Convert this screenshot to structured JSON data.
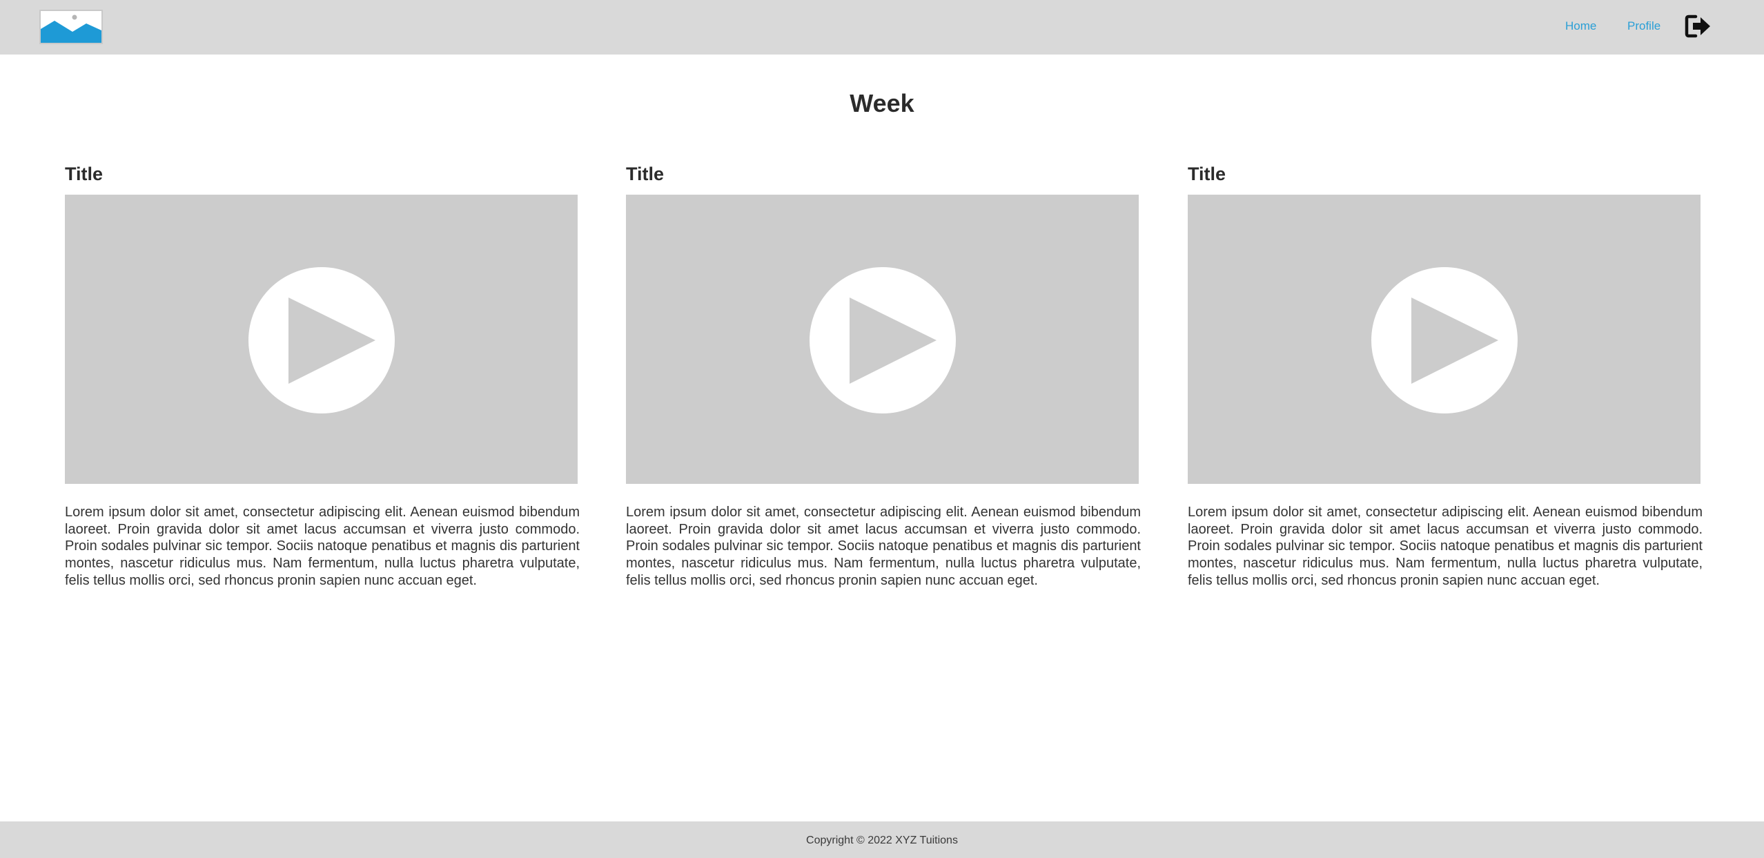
{
  "header": {
    "nav": {
      "home_label": "Home",
      "profile_label": "Profile"
    },
    "logo_icon": "image-placeholder-icon",
    "logout_icon": "sign-out-icon"
  },
  "page": {
    "title": "Week"
  },
  "cards": [
    {
      "title": "Title",
      "video_icon": "play-icon",
      "description": "Lorem ipsum dolor sit amet, consectetur adipiscing elit. Aenean euismod bibendum laoreet. Proin gravida dolor sit amet lacus accumsan et viverra justo commodo. Proin sodales pulvinar sic tempor. Sociis natoque penatibus et magnis dis parturient montes, nascetur ridiculus mus. Nam fermentum, nulla luctus pharetra vulputate, felis tellus mollis orci, sed rhoncus pronin sapien nunc accuan eget."
    },
    {
      "title": "Title",
      "video_icon": "play-icon",
      "description": "Lorem ipsum dolor sit amet, consectetur adipiscing elit. Aenean euismod bibendum laoreet. Proin gravida dolor sit amet lacus accumsan et viverra justo commodo. Proin sodales pulvinar sic tempor. Sociis natoque penatibus et magnis dis parturient montes, nascetur ridiculus mus. Nam fermentum, nulla luctus pharetra vulputate, felis tellus mollis orci, sed rhoncus pronin sapien nunc accuan eget."
    },
    {
      "title": "Title",
      "video_icon": "play-icon",
      "description": "Lorem ipsum dolor sit amet, consectetur adipiscing elit. Aenean euismod bibendum laoreet. Proin gravida dolor sit amet lacus accumsan et viverra justo commodo. Proin sodales pulvinar sic tempor. Sociis natoque penatibus et magnis dis parturient montes, nascetur ridiculus mus. Nam fermentum, nulla luctus pharetra vulputate, felis tellus mollis orci, sed rhoncus pronin sapien nunc accuan eget."
    }
  ],
  "footer": {
    "copyright": "Copyright © 2022 XYZ Tuitions"
  },
  "colors": {
    "header_bg": "#d9d9d9",
    "link": "#2a9fd6",
    "video_bg": "#cccccc",
    "logo_accent": "#1e9ad6"
  }
}
